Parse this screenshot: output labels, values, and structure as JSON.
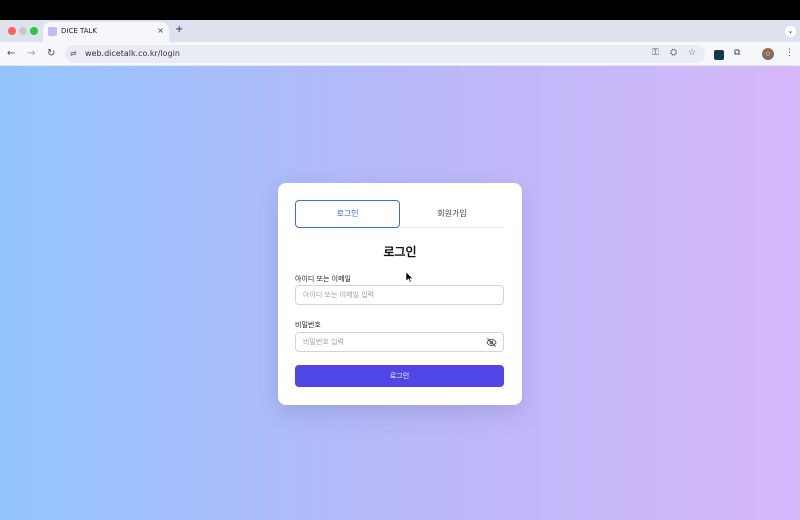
{
  "browser": {
    "tab_title": "DICE TALK",
    "tab_close": "×",
    "new_tab": "+",
    "url": "web.dicetalk.co.kr/login",
    "nav_back": "←",
    "nav_forward": "→",
    "nav_reload": "↻",
    "site_info": "⇌",
    "password_icon": "⚿",
    "translate_icon": "⛭",
    "bookmark_icon": "☆",
    "extensions_icon": "⧉",
    "menu": "⋮",
    "tab_menu": "⌄",
    "avatar_text": "○"
  },
  "login": {
    "tabs": {
      "login": "로그인",
      "signup": "회원가입"
    },
    "title": "로그인",
    "id_label": "아이디 또는 이메일",
    "id_placeholder": "아이디 또는 이메일 입력",
    "pw_label": "비밀번호",
    "pw_placeholder": "비밀번호 입력",
    "submit": "로그인"
  },
  "colors": {
    "accent": "#4f46e5",
    "tab_active_border": "#3b6fd8",
    "background_left": "#93c5fd",
    "background_right": "#d6b8fb"
  }
}
